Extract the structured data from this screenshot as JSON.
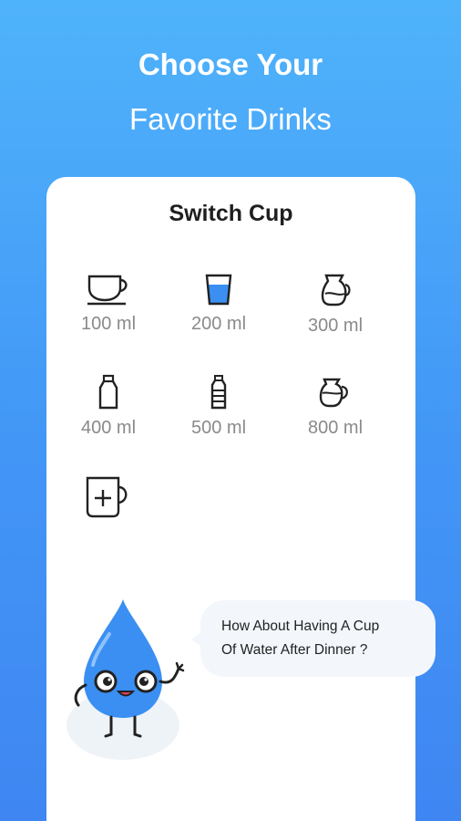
{
  "header": {
    "line1": "Choose Your",
    "line2": "Favorite Drinks"
  },
  "card": {
    "title": "Switch Cup",
    "cups": [
      {
        "label": "100 ml",
        "icon": "coffee-cup-icon"
      },
      {
        "label": "200 ml",
        "icon": "water-glass-icon"
      },
      {
        "label": "300 ml",
        "icon": "jug-icon"
      },
      {
        "label": "400 ml",
        "icon": "milk-bottle-icon"
      },
      {
        "label": "500 ml",
        "icon": "water-bottle-icon"
      },
      {
        "label": "800 ml",
        "icon": "pitcher-icon"
      }
    ],
    "custom_icon": "add-custom-cup-icon"
  },
  "tip": {
    "line1": "How About Having A Cup",
    "line2": "Of Water After Dinner ?"
  },
  "colors": {
    "accent": "#4296f6",
    "water": "#3b8ff2"
  }
}
